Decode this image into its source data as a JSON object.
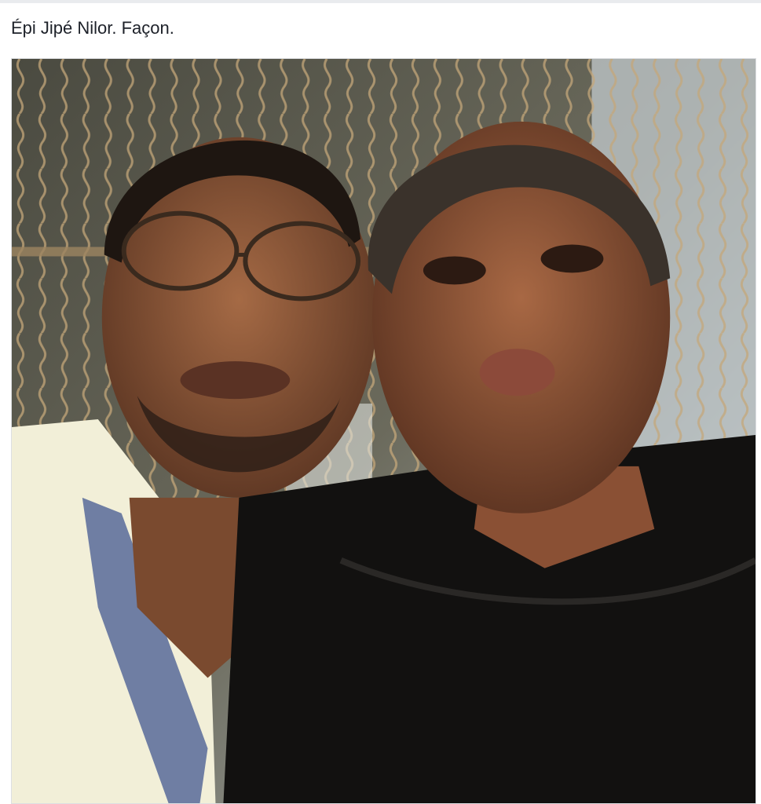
{
  "post": {
    "caption": "Épi Jipé Nilor. Façon."
  },
  "photo": {
    "subject": "selfie-two-men"
  },
  "colors": {
    "caption_text": "#1d2129",
    "background": "#ffffff",
    "divider": "#e9ebee"
  }
}
